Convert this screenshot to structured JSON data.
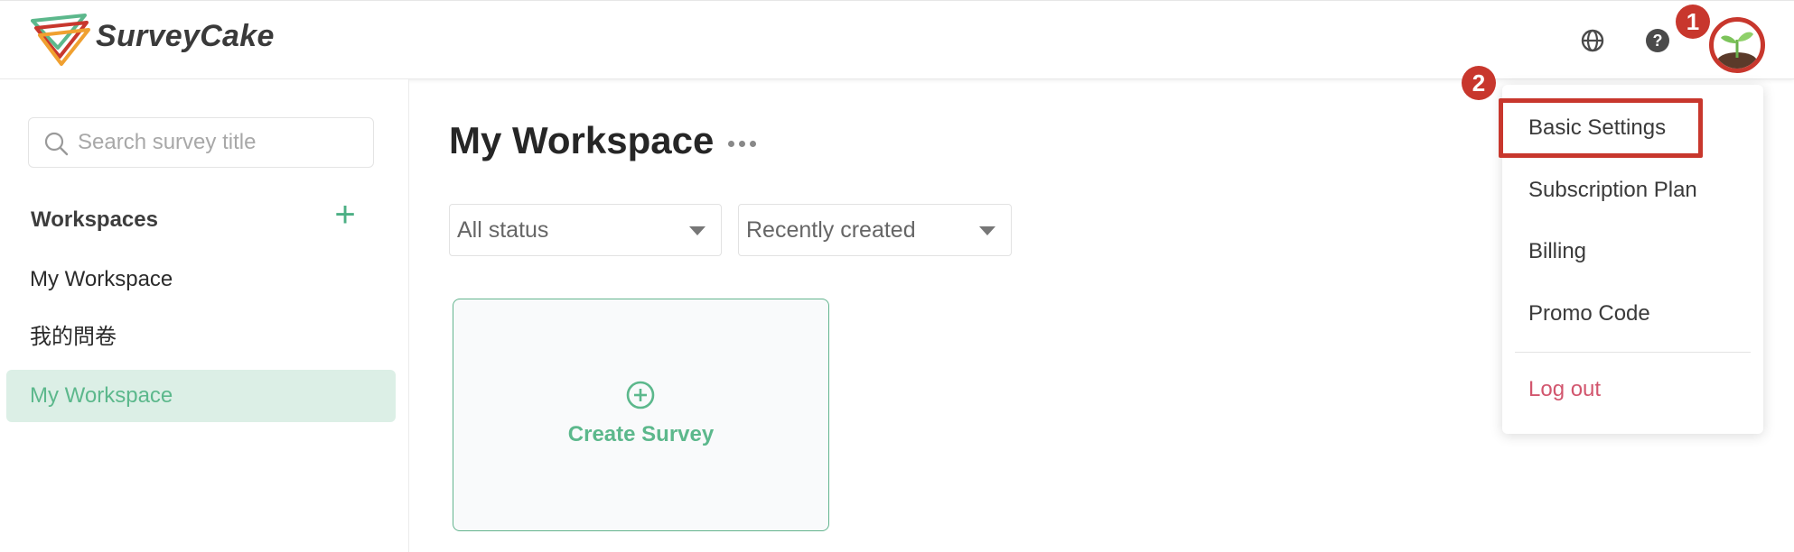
{
  "header": {
    "brand": "SurveyCake",
    "help_glyph": "?",
    "icons": [
      "logo-icon",
      "globe-icon",
      "help-icon",
      "avatar-sprout-icon"
    ],
    "annotation_1": "1",
    "annotation_2": "2"
  },
  "sidebar": {
    "search_placeholder": "Search survey title",
    "workspaces_heading": "Workspaces",
    "add_symbol": "+",
    "items": [
      {
        "label": "My Workspace"
      },
      {
        "label": "我的問卷"
      },
      {
        "label": "My Workspace",
        "active": true
      }
    ]
  },
  "main": {
    "title": "My Workspace",
    "status_filter": "All status",
    "sort_filter": "Recently created",
    "create_label": "Create Survey"
  },
  "menu": {
    "items": [
      {
        "label": "Basic Settings"
      },
      {
        "label": "Subscription Plan"
      },
      {
        "label": "Billing"
      },
      {
        "label": "Promo Code"
      }
    ],
    "logout": "Log out"
  },
  "colors": {
    "accent": "#5cb88c",
    "annotation": "#c8372d",
    "logout": "#d2566e"
  }
}
